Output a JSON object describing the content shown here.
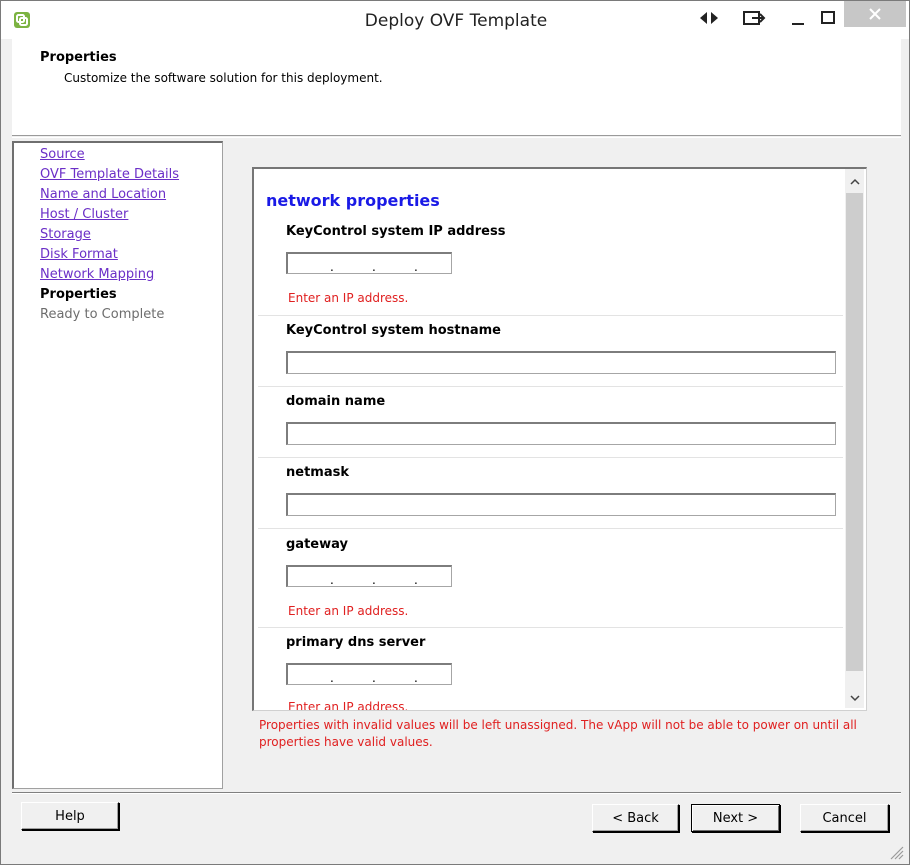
{
  "window": {
    "title": "Deploy OVF Template"
  },
  "header": {
    "title": "Properties",
    "subtitle": "Customize the software solution for this deployment."
  },
  "sidebar": {
    "items": [
      {
        "label": "Source",
        "state": "link"
      },
      {
        "label": "OVF Template Details",
        "state": "link"
      },
      {
        "label": "Name and Location",
        "state": "link"
      },
      {
        "label": "Host / Cluster",
        "state": "link"
      },
      {
        "label": "Storage",
        "state": "link"
      },
      {
        "label": "Disk Format",
        "state": "link"
      },
      {
        "label": "Network Mapping",
        "state": "link"
      },
      {
        "label": "Properties",
        "state": "current"
      },
      {
        "label": "Ready to Complete",
        "state": "disabled"
      }
    ]
  },
  "main": {
    "section_title": "network properties",
    "fields": [
      {
        "label": "KeyControl system IP address",
        "type": "ip",
        "value": "",
        "error": "Enter an IP address."
      },
      {
        "label": "KeyControl system hostname",
        "type": "text",
        "value": ""
      },
      {
        "label": "domain name",
        "type": "text",
        "value": ""
      },
      {
        "label": "netmask",
        "type": "text",
        "value": ""
      },
      {
        "label": "gateway",
        "type": "ip",
        "value": "",
        "error": "Enter an IP address."
      },
      {
        "label": "primary dns server",
        "type": "ip",
        "value": "",
        "error": "Enter an IP address."
      }
    ],
    "warning": "Properties with invalid values will be left unassigned. The vApp will not be able to power on until all properties have valid values."
  },
  "footer": {
    "help": "Help",
    "back": "< Back",
    "next": "Next >",
    "cancel": "Cancel"
  },
  "colors": {
    "link": "#6b2fc7",
    "error": "#e02020",
    "section_title": "#1a1ae6"
  }
}
